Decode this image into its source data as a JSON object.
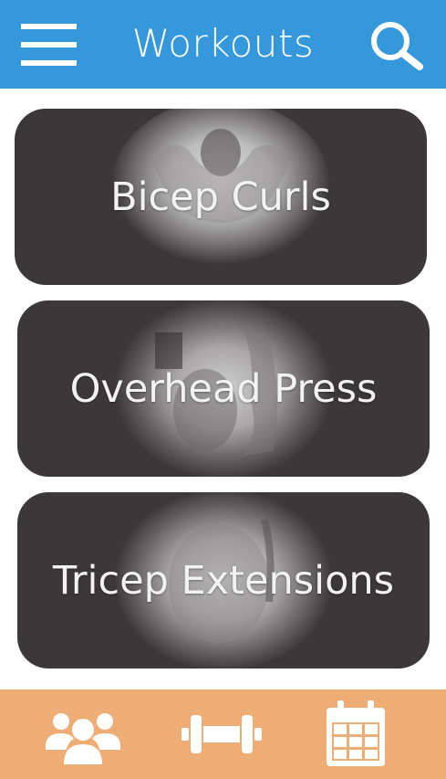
{
  "app": {
    "header_title": "Workouts"
  },
  "icons": {
    "menu": "hamburger-menu-icon",
    "search": "magnifying-glass-icon",
    "community": "users-group-icon",
    "workouts": "dumbbell-icon",
    "schedule": "calendar-icon"
  },
  "colors": {
    "header": "#3498db",
    "card": "#3c3839",
    "footer": "#efad76",
    "icon": "#ffffff"
  },
  "workouts": [
    {
      "title": "Bicep Curls"
    },
    {
      "title": "Overhead Press"
    },
    {
      "title": "Tricep Extensions"
    }
  ]
}
